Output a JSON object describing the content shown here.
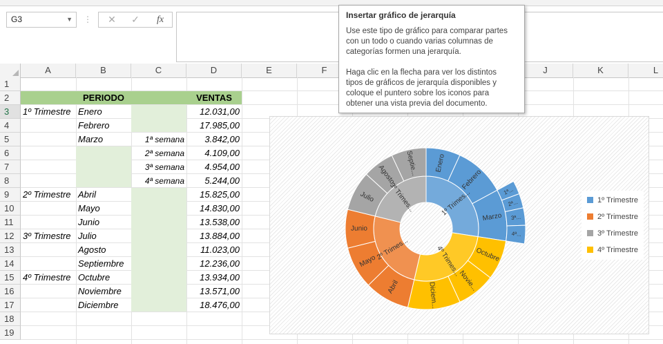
{
  "formula_bar": {
    "name_box": "G3",
    "cancel_icon": "✕",
    "enter_icon": "✓",
    "fx_icon": "fx",
    "formula": ""
  },
  "columns": [
    "A",
    "B",
    "C",
    "D",
    "E",
    "F",
    "G",
    "H",
    "I",
    "J",
    "K",
    "L"
  ],
  "rows": [
    "1",
    "2",
    "3",
    "4",
    "5",
    "6",
    "7",
    "8",
    "9",
    "10",
    "11",
    "12",
    "13",
    "14",
    "15",
    "16",
    "17",
    "18",
    "19"
  ],
  "table": {
    "header_periodo": "PERIODO",
    "header_ventas": "VENTAS",
    "quarters": [
      "1º Trimestre",
      "2º Trimestre",
      "3º Trimestre",
      "4º Trimestre"
    ],
    "months": [
      "Enero",
      "Febrero",
      "Marzo",
      "Abril",
      "Mayo",
      "Junio",
      "Julio",
      "Agosto",
      "Septiembre",
      "Octubre",
      "Noviembre",
      "Diciembre"
    ],
    "weeks": [
      "1ª semana",
      "2ª semana",
      "3ª semana",
      "4ª semana"
    ],
    "sales": [
      "12.031,00",
      "17.985,00",
      "3.842,00",
      "4.109,00",
      "4.954,00",
      "5.244,00",
      "15.825,00",
      "14.830,00",
      "13.538,00",
      "13.884,00",
      "11.023,00",
      "12.236,00",
      "13.934,00",
      "13.571,00",
      "18.476,00"
    ]
  },
  "tooltip": {
    "title": "Insertar gráfico de jerarquía",
    "p1": [
      "Use este tipo de gráfico para comparar partes",
      "con un todo o cuando varias columnas de",
      "categorías formen una jerarquía."
    ],
    "p2": [
      "Haga clic en la flecha para ver los distintos",
      "tipos de gráficos de jerarquía disponibles y",
      "coloque el puntero sobre los iconos para",
      "obtener una vista previa del documento."
    ]
  },
  "chart_data": {
    "type": "sunburst",
    "legend_position": "right",
    "colors": {
      "1º Trimestre": "#5b9bd5",
      "2º Trimestre": "#ed7d31",
      "3º Trimestre": "#a5a5a5",
      "4º Trimestre": "#ffc000"
    },
    "rings": [
      {
        "level": 1,
        "items": [
          {
            "name": "1º Trimestre",
            "label": "1º Trimes...",
            "value": 48165
          },
          {
            "name": "4º Trimestre",
            "label": "4º Trimes...",
            "value": 45981
          },
          {
            "name": "2º Trimestre",
            "label": "2º Trimes...",
            "value": 44193
          },
          {
            "name": "3º Trimestre",
            "label": "3º Trimes...",
            "value": 37143
          }
        ]
      },
      {
        "level": 2,
        "items": [
          {
            "name": "Enero",
            "label": "Enero",
            "parent": "1º Trimestre",
            "value": 12031
          },
          {
            "name": "Febrero",
            "label": "Febrero",
            "parent": "1º Trimestre",
            "value": 17985
          },
          {
            "name": "Marzo",
            "label": "Marzo",
            "parent": "1º Trimestre",
            "value": 18149
          },
          {
            "name": "Octubre",
            "label": "Octubre",
            "parent": "4º Trimestre",
            "value": 13934
          },
          {
            "name": "Noviembre",
            "label": "Novie...",
            "parent": "4º Trimestre",
            "value": 13571
          },
          {
            "name": "Diciembre",
            "label": "Diciem...",
            "parent": "4º Trimestre",
            "value": 18476
          },
          {
            "name": "Abril",
            "label": "Abril",
            "parent": "2º Trimestre",
            "value": 15825
          },
          {
            "name": "Mayo",
            "label": "Mayo",
            "parent": "2º Trimestre",
            "value": 14830
          },
          {
            "name": "Junio",
            "label": "Junio",
            "parent": "2º Trimestre",
            "value": 13538
          },
          {
            "name": "Julio",
            "label": "Julio",
            "parent": "3º Trimestre",
            "value": 13884
          },
          {
            "name": "Agosto",
            "label": "Agosto",
            "parent": "3º Trimestre",
            "value": 11023
          },
          {
            "name": "Septiembre",
            "label": "Septie...",
            "parent": "3º Trimestre",
            "value": 12236
          }
        ]
      },
      {
        "level": 3,
        "items": [
          {
            "name": "1ª semana",
            "label": "1ª...",
            "parent": "Marzo",
            "value": 3842
          },
          {
            "name": "2ª semana",
            "label": "2ª...",
            "parent": "Marzo",
            "value": 4109
          },
          {
            "name": "3ª semana",
            "label": "3ª...",
            "parent": "Marzo",
            "value": 4954
          },
          {
            "name": "4ª semana",
            "label": "4ª...",
            "parent": "Marzo",
            "value": 5244
          }
        ]
      }
    ]
  }
}
